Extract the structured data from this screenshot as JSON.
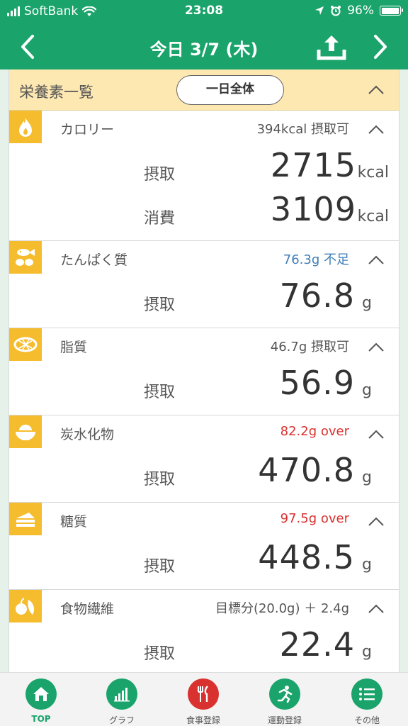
{
  "status": {
    "carrier": "SoftBank",
    "time": "23:08",
    "battery": "96%",
    "battery_level": 0.96
  },
  "nav": {
    "title": "今日 3/7 (木)"
  },
  "summary": {
    "label": "栄養素一覧",
    "toggle": "一日全体"
  },
  "sections": [
    {
      "id": "calorie",
      "name": "カロリー",
      "status": "394kcal 摂取可",
      "status_color": "#555555",
      "rows": [
        {
          "label": "摂取",
          "value": "2715",
          "unit": "kcal"
        },
        {
          "label": "消費",
          "value": "3109",
          "unit": "kcal"
        }
      ]
    },
    {
      "id": "protein",
      "name": "たんぱく質",
      "status": "76.3g 不足",
      "status_color": "#3e7fb7",
      "rows": [
        {
          "label": "摂取",
          "value": "76.8",
          "unit": "g"
        }
      ]
    },
    {
      "id": "fat",
      "name": "脂質",
      "status": "46.7g 摂取可",
      "status_color": "#555555",
      "rows": [
        {
          "label": "摂取",
          "value": "56.9",
          "unit": "g"
        }
      ]
    },
    {
      "id": "carbs",
      "name": "炭水化物",
      "status": "82.2g over",
      "status_color": "#d9312f",
      "rows": [
        {
          "label": "摂取",
          "value": "470.8",
          "unit": "g"
        }
      ]
    },
    {
      "id": "sugar",
      "name": "糖質",
      "status": "97.5g over",
      "status_color": "#d9312f",
      "rows": [
        {
          "label": "摂取",
          "value": "448.5",
          "unit": "g"
        }
      ]
    },
    {
      "id": "fiber",
      "name": "食物繊維",
      "status": "目標分(20.0g) ＋ 2.4g",
      "status_color": "#555555",
      "rows": [
        {
          "label": "摂取",
          "value": "22.4",
          "unit": "g"
        }
      ]
    }
  ],
  "tabs": [
    {
      "label": "TOP",
      "icon": "home-icon",
      "color": "#1aa36b"
    },
    {
      "label": "グラフ",
      "icon": "bar-chart-icon",
      "color": "#1aa36b"
    },
    {
      "label": "食事登録",
      "icon": "fork-knife-icon",
      "color": "#d9312f"
    },
    {
      "label": "運動登録",
      "icon": "runner-icon",
      "color": "#1aa36b"
    },
    {
      "label": "その他",
      "icon": "list-icon",
      "color": "#1aa36b"
    }
  ],
  "colors": {
    "header_green": "#1aa36b",
    "icon_yellow": "#f5bd2e",
    "summary_bg": "#fde8b1"
  }
}
